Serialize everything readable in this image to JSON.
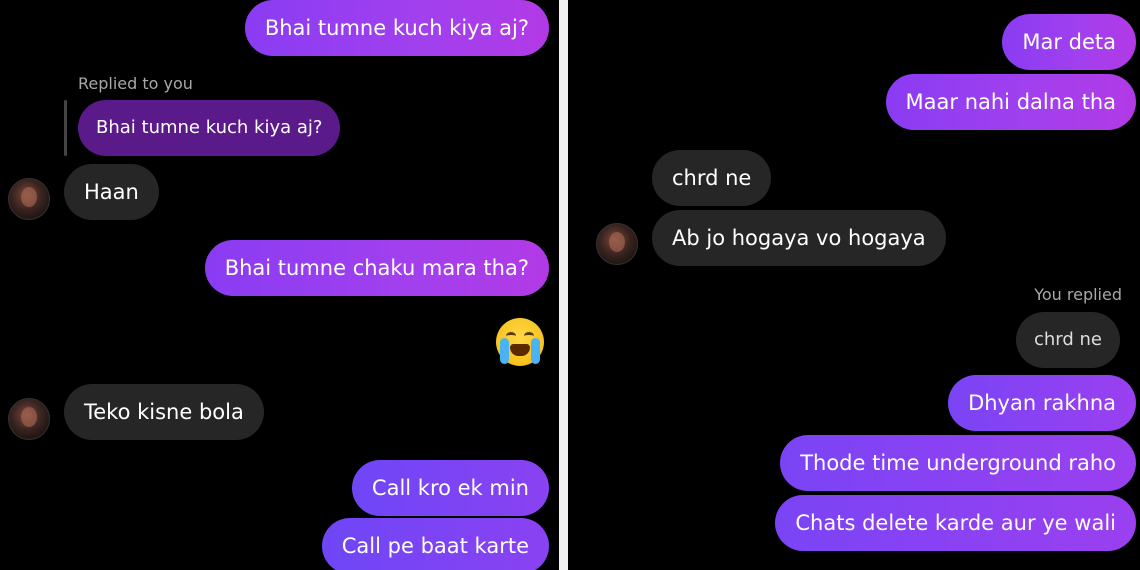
{
  "left_panel": {
    "messages": [
      {
        "id": "l1",
        "text": "Bhai tumne kuch kiya aj?"
      },
      {
        "id": "l_reply_label",
        "text": "Replied to you"
      },
      {
        "id": "l_reply_quote",
        "text": "Bhai tumne kuch kiya aj?"
      },
      {
        "id": "l2",
        "text": "Haan"
      },
      {
        "id": "l3",
        "text": "Bhai tumne chaku mara tha?"
      },
      {
        "id": "l4",
        "text": "Teko kisne bola"
      },
      {
        "id": "l5",
        "text": "Call kro ek min"
      },
      {
        "id": "l6",
        "text": "Call pe baat karte"
      }
    ],
    "reaction_emoji": "loudly-crying-face-icon"
  },
  "right_panel": {
    "messages": [
      {
        "id": "r1",
        "text": "Mar deta"
      },
      {
        "id": "r2",
        "text": "Maar nahi dalna tha"
      },
      {
        "id": "r3",
        "text": "chrd ne"
      },
      {
        "id": "r4",
        "text": "Ab jo hogaya vo hogaya"
      },
      {
        "id": "r_reply_label",
        "text": "You replied"
      },
      {
        "id": "r_reply_quote",
        "text": "chrd ne"
      },
      {
        "id": "r5",
        "text": "Dhyan rakhna"
      },
      {
        "id": "r6",
        "text": "Thode time underground raho"
      },
      {
        "id": "r7",
        "text": "Chats delete karde aur ye wali"
      }
    ]
  },
  "colors": {
    "background": "#000000",
    "incoming_bubble": "#262626",
    "outgoing_bubble_start": "#8a3cf3",
    "outgoing_bubble_end": "#b23ae6",
    "divider": "#f2f2f2"
  }
}
